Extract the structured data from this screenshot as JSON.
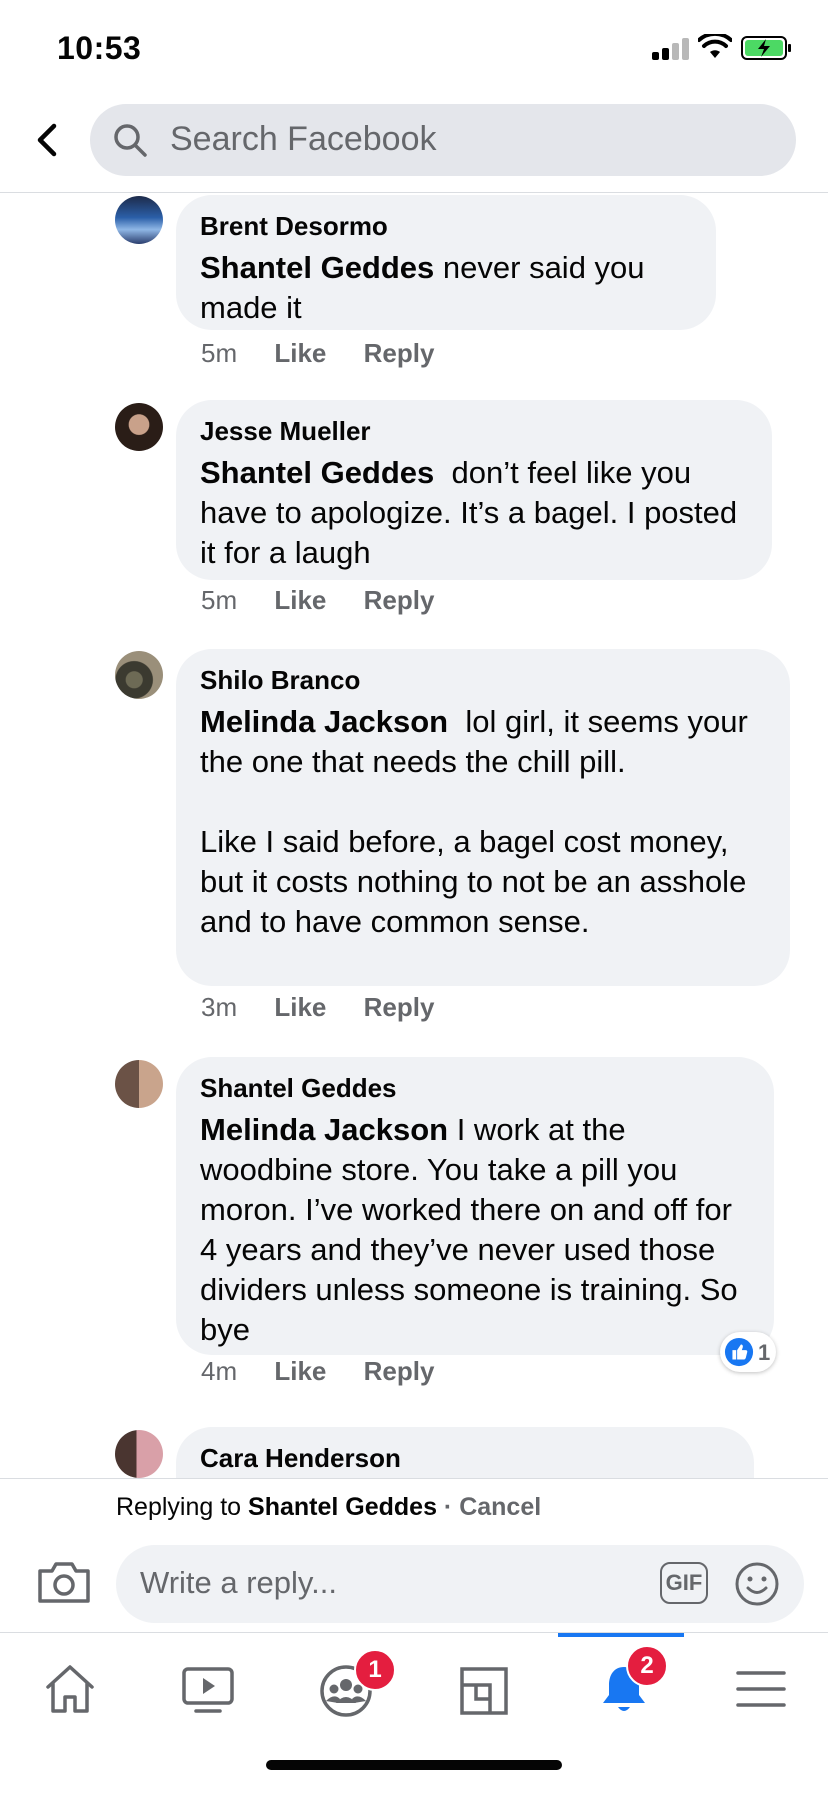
{
  "status": {
    "time": "10:53"
  },
  "search": {
    "placeholder": "Search Facebook"
  },
  "comments": [
    {
      "author": "Brent Desormo",
      "mention": "Shantel Geddes",
      "text": " never said you made it",
      "time": "5m",
      "like": "Like",
      "reply": "Reply"
    },
    {
      "author": "Jesse Mueller",
      "mention": "Shantel Geddes",
      "text": "  don’t feel like you have to apologize. It’s a bagel. I posted it for a laugh",
      "time": "5m",
      "like": "Like",
      "reply": "Reply"
    },
    {
      "author": "Shilo Branco",
      "mention": "Melinda Jackson",
      "text": "  lol girl, it seems your the one that needs the chill pill.\n\nLike I said before, a bagel cost money, but it costs nothing to not be an asshole and to have common sense.",
      "time": "3m",
      "like": "Like",
      "reply": "Reply"
    },
    {
      "author": "Shantel Geddes",
      "mention": "Melinda Jackson",
      "text": " I work at the woodbine store. You take a pill you moron. I’ve worked there on and off for 4 years and they’ve never used those dividers unless someone is training. So bye",
      "time": "4m",
      "like": "Like",
      "reply": "Reply",
      "reaction_count": "1"
    },
    {
      "author": "Cara Henderson"
    }
  ],
  "reply_bar": {
    "replying_prefix": "Replying to ",
    "replying_to": "Shantel Geddes",
    "separator": " · ",
    "cancel": "Cancel",
    "placeholder": "Write a reply...",
    "gif_label": "GIF"
  },
  "tabs": {
    "groups_badge": "1",
    "notifications_badge": "2",
    "active_color": "#1877f2",
    "badge_color": "#e41e3f"
  }
}
